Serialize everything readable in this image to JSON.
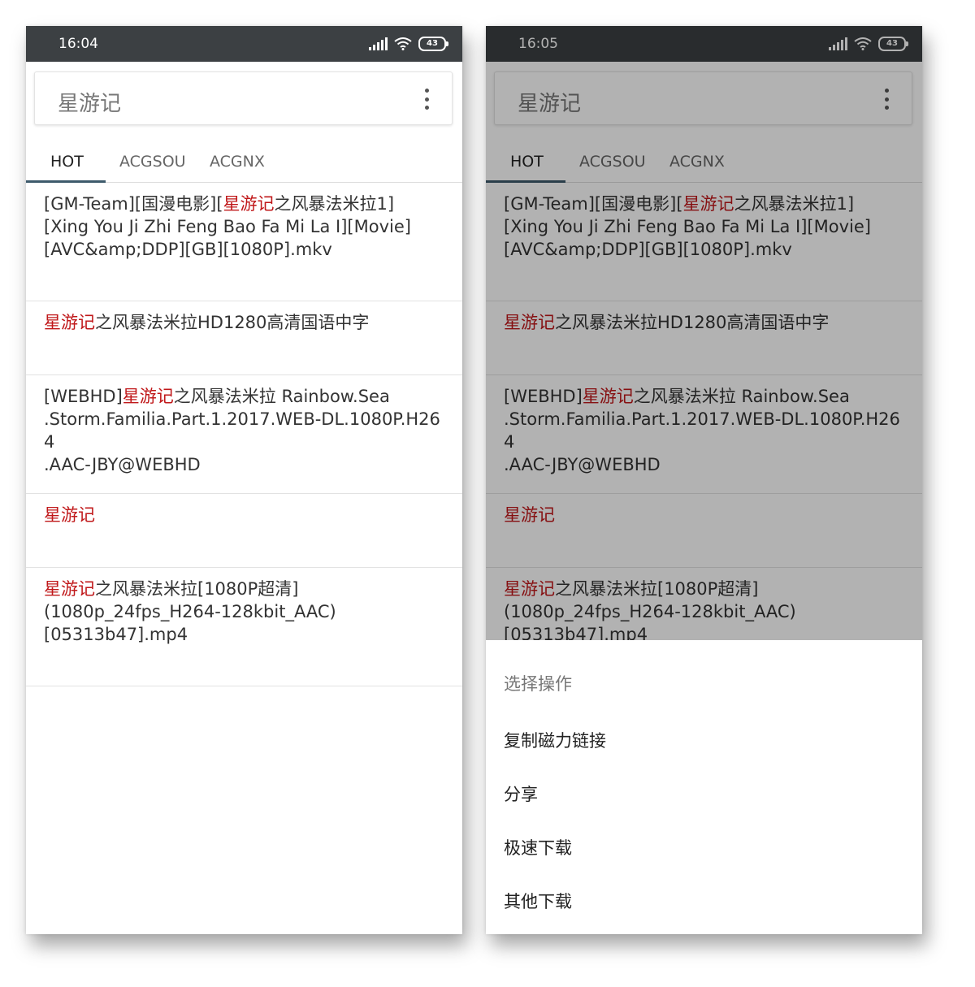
{
  "left_screen": {
    "status": {
      "time": "16:04",
      "battery": "43"
    },
    "search": {
      "query": "星游记"
    },
    "tabs": [
      "HOT",
      "ACGSOU",
      "ACGNX"
    ],
    "results": [
      {
        "pre": "[GM-Team][国漫电影][",
        "hl": "星游记",
        "post": "之风暴法米拉1]\n[Xing You Ji Zhi Feng Bao Fa Mi La I][Movie]\n[AVC&amp;DDP][GB][1080P].mkv"
      },
      {
        "pre": "",
        "hl": "星游记",
        "post": "之风暴法米拉HD1280高清国语中字"
      },
      {
        "pre": "[WEBHD]",
        "hl": "星游记",
        "post": "之风暴法米拉 Rainbow.Sea\n.Storm.Familia.Part.1.2017.WEB-DL.1080P.H264\n.AAC-JBY@WEBHD"
      },
      {
        "pre": "",
        "hl": "星游记",
        "post": ""
      },
      {
        "pre": "",
        "hl": "星游记",
        "post": "之风暴法米拉[1080P超清]\n(1080p_24fps_H264-128kbit_AAC)\n[05313b47].mp4"
      }
    ]
  },
  "right_screen": {
    "status": {
      "time": "16:05",
      "battery": "43"
    },
    "search": {
      "query": "星游记"
    },
    "tabs": [
      "HOT",
      "ACGSOU",
      "ACGNX"
    ],
    "results": [
      {
        "pre": "[GM-Team][国漫电影][",
        "hl": "星游记",
        "post": "之风暴法米拉1]\n[Xing You Ji Zhi Feng Bao Fa Mi La I][Movie]\n[AVC&amp;DDP][GB][1080P].mkv"
      },
      {
        "pre": "",
        "hl": "星游记",
        "post": "之风暴法米拉HD1280高清国语中字"
      },
      {
        "pre": "[WEBHD]",
        "hl": "星游记",
        "post": "之风暴法米拉 Rainbow.Sea\n.Storm.Familia.Part.1.2017.WEB-DL.1080P.H264\n.AAC-JBY@WEBHD"
      },
      {
        "pre": "",
        "hl": "星游记",
        "post": ""
      },
      {
        "pre": "",
        "hl": "星游记",
        "post": "之风暴法米拉[1080P超清]\n(1080p_24fps_H264-128kbit_AAC)\n[05313b47].mp4"
      }
    ],
    "action_sheet": {
      "title": "选择操作",
      "options": [
        "复制磁力链接",
        "分享",
        "极速下载",
        "其他下载"
      ]
    }
  },
  "colors": {
    "status_bar": "#3c4043",
    "highlight": "#c0181a",
    "tab_indicator": "#3d5a6b",
    "dim_overlay": "rgba(0,0,0,0.3)"
  },
  "icons": [
    "signal-icon",
    "wifi-icon",
    "battery-icon",
    "more-options-icon"
  ]
}
